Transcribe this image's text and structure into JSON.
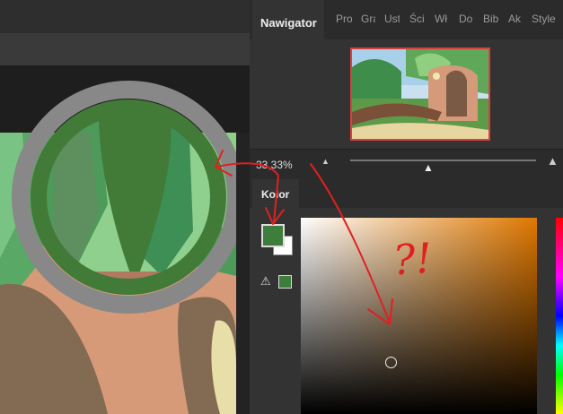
{
  "panel_tabs": {
    "navigator": "Nawigator",
    "others": [
      "Pro",
      "Gra",
      "Ust",
      "Ści",
      "Wł",
      "Do",
      "Bib",
      "Ak",
      "Style"
    ]
  },
  "navigator": {
    "zoom_value": "33,33%",
    "zoom_slider_fraction": 0.42
  },
  "color_panel": {
    "tab_label": "Kolor",
    "foreground_color": "#3f7d3d",
    "background_color": "#ffffff",
    "warning_icon": "warning-triangle-icon"
  },
  "annotation": {
    "text": "?!",
    "color": "#e02020"
  },
  "colors": {
    "panel_bg": "#333333",
    "accent_red": "#d84040"
  }
}
